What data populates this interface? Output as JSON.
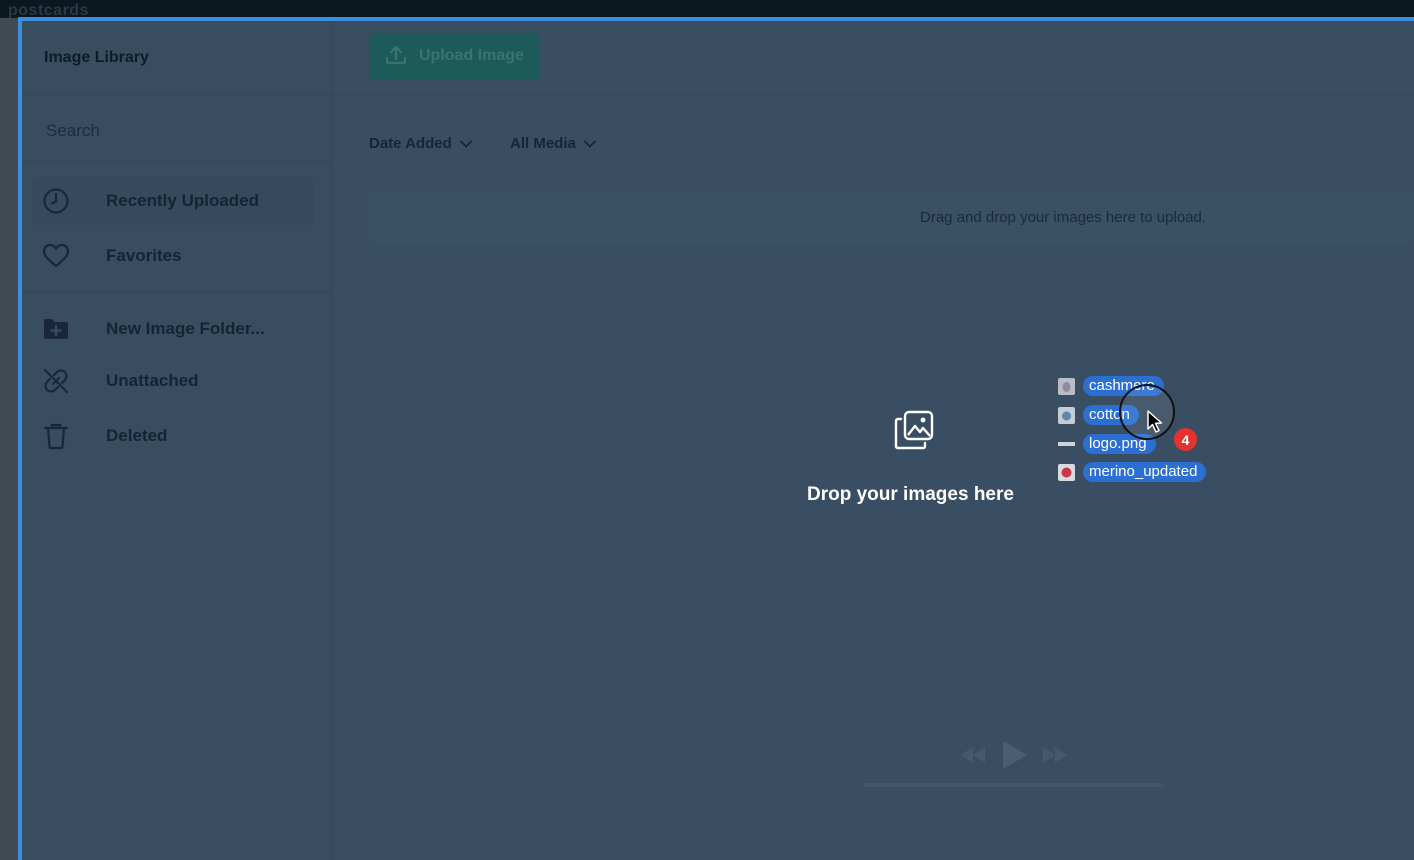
{
  "app": {
    "brand": "postcards"
  },
  "modal": {
    "title": "Image Library"
  },
  "sidebar": {
    "search_placeholder": "Search",
    "items": [
      {
        "label": "Recently Uploaded",
        "icon": "clock-icon",
        "active": true
      },
      {
        "label": "Favorites",
        "icon": "heart-icon"
      },
      {
        "label": "New Image Folder...",
        "icon": "folder-plus-icon"
      },
      {
        "label": "Unattached",
        "icon": "unlink-icon"
      },
      {
        "label": "Deleted",
        "icon": "trash-icon"
      }
    ]
  },
  "toolbar": {
    "upload_label": "Upload Image"
  },
  "filters": {
    "sort_label": "Date Added",
    "media_label": "All Media"
  },
  "drag_area": {
    "hint": "Drag and drop your images here to upload."
  },
  "drop_zone": {
    "text": "Drop your images here"
  },
  "dragged_files": {
    "count": "4",
    "files": [
      {
        "name": "cashmere"
      },
      {
        "name": "cotton"
      },
      {
        "name": "logo.png"
      },
      {
        "name": "merino_updated"
      }
    ]
  },
  "colors": {
    "accent_border": "#3b8fe0",
    "file_chip": "#2b6fd2",
    "badge": "#e6322f",
    "upload_button": "#1d5a5a"
  }
}
